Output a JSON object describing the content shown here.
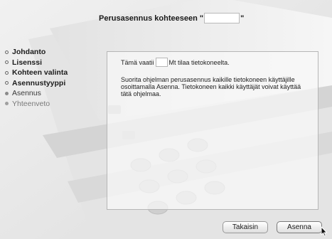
{
  "window": {
    "title_prefix": "Perusasennus kohteeseen \"",
    "title_suffix": "\""
  },
  "sidebar": {
    "steps": [
      {
        "label": "Johdanto",
        "state": "done"
      },
      {
        "label": "Lisenssi",
        "state": "done"
      },
      {
        "label": "Kohteen valinta",
        "state": "done"
      },
      {
        "label": "Asennustyyppi",
        "state": "done"
      },
      {
        "label": "Asennus",
        "state": "current"
      },
      {
        "label": "Yhteenveto",
        "state": "todo"
      }
    ]
  },
  "content": {
    "space_prefix": "Tämä vaatii",
    "space_suffix": "Mt tilaa tietokoneelta.",
    "description": "Suorita ohjelman perusasennus kaikille tietokoneen käyttäjille osoittamalla Asenna. Tietokoneen kaikki käyttäjät voivat käyttää tätä ohjelmaa."
  },
  "buttons": {
    "back": "Takaisin",
    "install": "Asenna"
  },
  "icons": {
    "background": "copier-illustration",
    "cursor": "mouse-pointer-icon"
  }
}
